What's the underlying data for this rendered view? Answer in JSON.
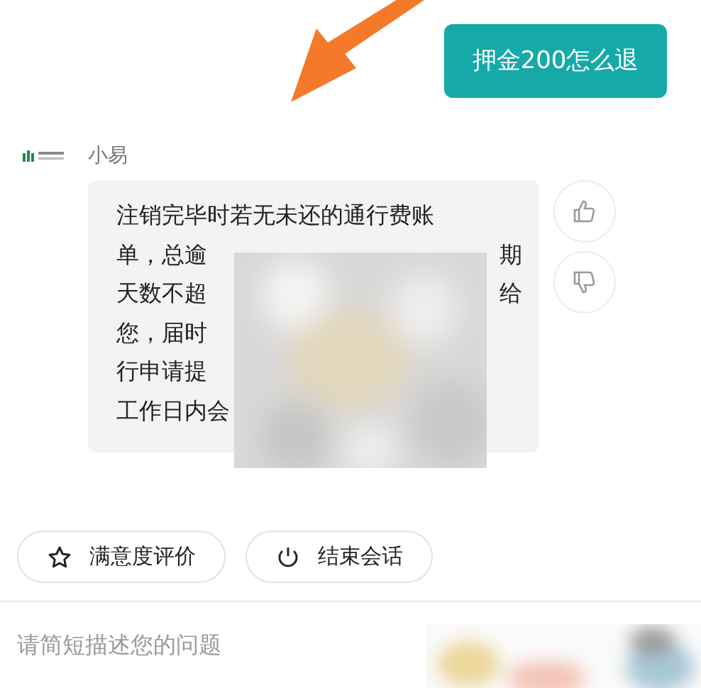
{
  "user_message": {
    "text": "押金200怎么退"
  },
  "bot": {
    "name": "小易"
  },
  "bot_message": {
    "lines": [
      {
        "left": "注销完毕时若无未还的通行费账"
      },
      {
        "left": "单，总逾",
        "right": "期"
      },
      {
        "left": "天数不超",
        "right": "给"
      },
      {
        "left": "您，届时"
      },
      {
        "left": "行申请提"
      },
      {
        "left": "工作日内会"
      }
    ]
  },
  "quick_actions": [
    {
      "kind": "rate",
      "label": "满意度评价"
    },
    {
      "kind": "end",
      "label": "结束会话"
    }
  ],
  "input": {
    "placeholder": "请简短描述您的问题"
  }
}
